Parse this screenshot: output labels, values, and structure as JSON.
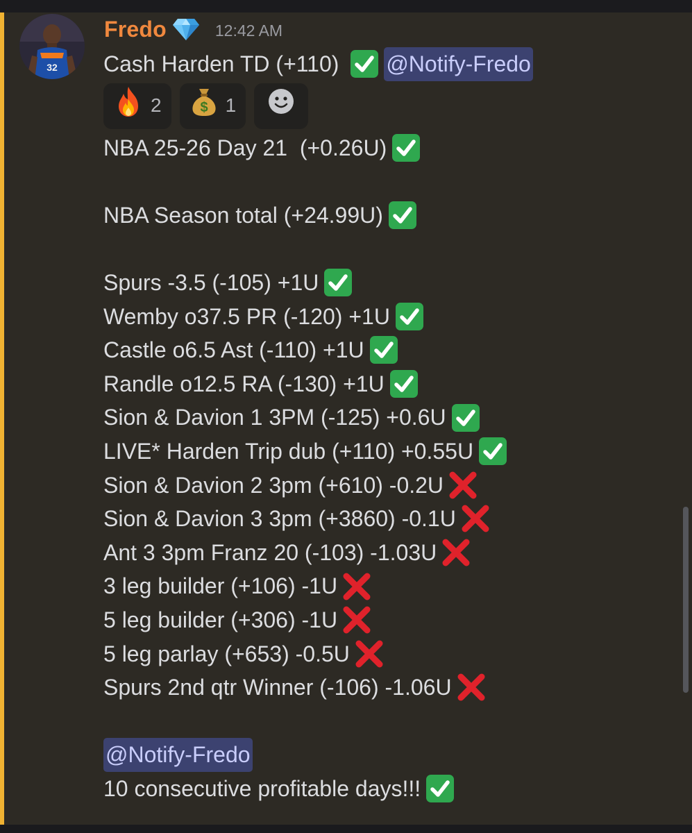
{
  "message": {
    "author": "Fredo",
    "author_badge_icon": "gem-icon",
    "timestamp": "12:42 AM",
    "colors": {
      "author": "#f0883e",
      "highlight": "#f0b232",
      "mention_bg": "#3c4270",
      "mention_text": "#c9cdfb",
      "check": "#2fa84f",
      "cross": "#e0222b"
    },
    "first_line": {
      "text": "Cash Harden TD (+110) ",
      "status": "check",
      "mention": "@Notify-Fredo"
    },
    "reactions": [
      {
        "icon": "fire-emoji",
        "count": "2"
      },
      {
        "icon": "money-bag-emoji",
        "count": "1"
      },
      {
        "icon": "add-reaction-icon",
        "count": ""
      }
    ],
    "day_line": {
      "text": "NBA 25-26 Day 21  (+0.26U)",
      "status": "check"
    },
    "season_line": {
      "text": "NBA Season total (+24.99U)",
      "status": "check"
    },
    "bets": [
      {
        "text": "Spurs -3.5 (-105) +1U",
        "status": "check"
      },
      {
        "text": "Wemby o37.5 PR (-120) +1U",
        "status": "check"
      },
      {
        "text": "Castle o6.5 Ast (-110) +1U",
        "status": "check"
      },
      {
        "text": "Randle o12.5 RA (-130) +1U",
        "status": "check"
      },
      {
        "text": "Sion & Davion 1 3PM (-125) +0.6U",
        "status": "check"
      },
      {
        "text": "LIVE* Harden Trip dub (+110) +0.55U",
        "status": "check"
      },
      {
        "text": "Sion & Davion 2 3pm (+610) -0.2U",
        "status": "cross"
      },
      {
        "text": "Sion & Davion 3 3pm (+3860) -0.1U",
        "status": "cross"
      },
      {
        "text": "Ant 3 3pm Franz 20 (-103) -1.03U",
        "status": "cross"
      },
      {
        "text": "3 leg builder (+106) -1U",
        "status": "cross"
      },
      {
        "text": "5 leg builder (+306) -1U",
        "status": "cross"
      },
      {
        "text": "5 leg parlay (+653) -0.5U",
        "status": "cross"
      },
      {
        "text": "Spurs 2nd qtr Winner (-106) -1.06U",
        "status": "cross"
      }
    ],
    "mention_line": "@Notify-Fredo",
    "final_line": {
      "text": "10 consecutive profitable days!!!",
      "status": "check"
    }
  }
}
